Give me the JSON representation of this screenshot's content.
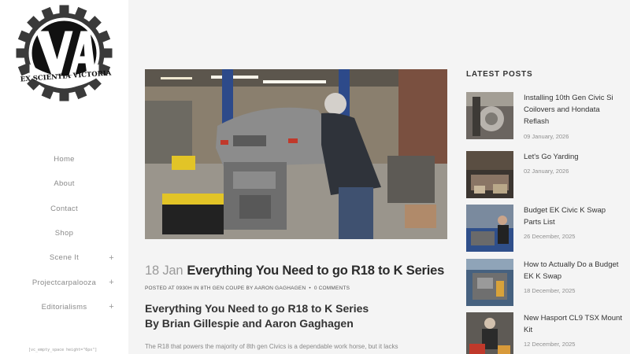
{
  "logo": {
    "letters": "VA",
    "motto": "EX SCIENTIA VICTORIA"
  },
  "nav": [
    {
      "label": "Home",
      "has_submenu": false
    },
    {
      "label": "About",
      "has_submenu": false
    },
    {
      "label": "Contact",
      "has_submenu": false
    },
    {
      "label": "Shop",
      "has_submenu": false
    },
    {
      "label": "Scene It",
      "has_submenu": true
    },
    {
      "label": "Projectcarpalooza",
      "has_submenu": true
    },
    {
      "label": "Editorialisms",
      "has_submenu": true
    }
  ],
  "submenu_symbol": "+",
  "shortcode_text": "[vc_empty_space height=\"6px\"]",
  "post": {
    "date": "18 Jan",
    "title": "Everything You Need to go R18 to K Series",
    "meta_posted": "POSTED AT 0930H IN 8TH GEN COUPE BY AARON GAGHAGEN",
    "meta_separator": "•",
    "meta_comments": "0 COMMENTS",
    "heading_line1": "Everything You Need to go R18 to K Series",
    "heading_line2": "By Brian Gillespie and Aaron Gaghagen",
    "excerpt": "The R18 that powers the majority of 8th gen Civics is a dependable work horse, but it lacks"
  },
  "sidebar_right": {
    "heading": "LATEST POSTS",
    "posts": [
      {
        "title": "Installing 10th Gen Civic Si Coilovers and Hondata Reflash",
        "date": "09 January, 2026"
      },
      {
        "title": "Let's Go Yarding",
        "date": "02 January, 2026"
      },
      {
        "title": "Budget EK Civic K Swap Parts List",
        "date": "26 December, 2025"
      },
      {
        "title": "How to Actually Do a Budget EK K Swap",
        "date": "18 December, 2025"
      },
      {
        "title": "New Hasport CL9 TSX Mount Kit",
        "date": "12 December, 2025"
      }
    ]
  },
  "colors": {
    "sidebar_bg": "#ffffff",
    "page_bg": "#f4f4f4",
    "text_dark": "#2b2b2b",
    "text_muted": "#8f8f8f"
  }
}
